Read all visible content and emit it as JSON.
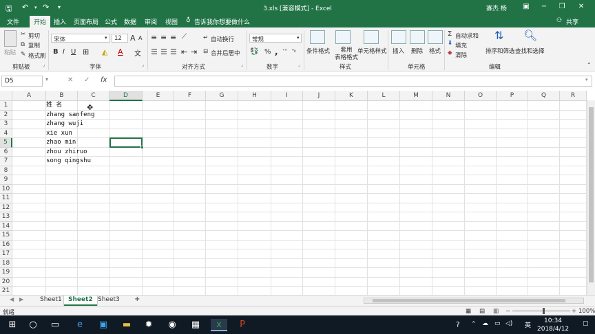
{
  "window": {
    "title": "3.xls [兼容模式] - Excel",
    "user": "寡杰 杨",
    "icons": [
      "save-icon",
      "undo-icon",
      "redo-icon",
      "customize-icon"
    ],
    "controls": [
      "ribbon-display-icon",
      "minimize-icon",
      "maximize-icon",
      "close-icon"
    ]
  },
  "menu": {
    "items": [
      "文件",
      "开始",
      "插入",
      "页面布局",
      "公式",
      "数据",
      "审阅",
      "视图"
    ],
    "active": "开始",
    "tell_me": "告诉我你想要做什么",
    "share": "共享"
  },
  "ribbon": {
    "clipboard": {
      "paste": "粘贴",
      "cut": "剪切",
      "copy": "复制",
      "format_painter": "格式刷",
      "label": "剪贴板"
    },
    "font": {
      "name": "宋体",
      "size": "12",
      "label": "字体",
      "bold": "B",
      "italic": "I",
      "underline": "U",
      "grow": "A",
      "shrink": "A",
      "font_color": "A"
    },
    "alignment": {
      "wrap": "自动换行",
      "merge": "合并后居中",
      "label": "对齐方式"
    },
    "number": {
      "format": "常规",
      "percent": "%",
      "comma": ",",
      "label": "数字"
    },
    "styles": {
      "conditional": "条件格式",
      "table": "套用\n表格格式",
      "cell_styles": "单元格样式",
      "label": "样式"
    },
    "cells": {
      "insert": "插入",
      "delete": "删除",
      "format": "格式",
      "label": "单元格"
    },
    "editing": {
      "autosum": "自动求和",
      "fill": "填充",
      "clear": "清除",
      "sort": "排序和筛选",
      "find": "查找和选择",
      "label": "编辑"
    }
  },
  "formula_bar": {
    "name_box": "D5",
    "fx": "fx",
    "value": ""
  },
  "grid": {
    "columns": [
      "A",
      "B",
      "C",
      "D",
      "E",
      "F",
      "G",
      "H",
      "I",
      "J",
      "K",
      "L",
      "M",
      "N",
      "O",
      "P",
      "Q",
      "R"
    ],
    "selected_column": "D",
    "rows": [
      "1",
      "2",
      "3",
      "4",
      "5",
      "6",
      "7",
      "8",
      "9",
      "10",
      "11",
      "12",
      "13",
      "14",
      "15",
      "16",
      "17",
      "18",
      "19",
      "20",
      "21"
    ],
    "selected_row": "5",
    "active_cell": "D5",
    "cells": [
      {
        "ref": "B1",
        "value": "姓 名"
      },
      {
        "ref": "B2",
        "value": "zhang sanfeng"
      },
      {
        "ref": "B3",
        "value": "zhang wuji"
      },
      {
        "ref": "B4",
        "value": "xie xun"
      },
      {
        "ref": "B5",
        "value": "zhao min"
      },
      {
        "ref": "B6",
        "value": "zhou zhiruo"
      },
      {
        "ref": "B7",
        "value": "song qingshu"
      }
    ]
  },
  "sheets": {
    "tabs": [
      "Sheet1",
      "Sheet2",
      "Sheet3"
    ],
    "active": "Sheet2",
    "add": "+"
  },
  "status": {
    "mode": "就绪",
    "zoom": "100%"
  },
  "taskbar": {
    "time": "10:34",
    "date": "2018/4/12",
    "ime": "英",
    "apps": [
      "start-icon",
      "search-icon",
      "task-view-icon",
      "edge-icon",
      "app-icon",
      "explorer-icon",
      "settings-icon",
      "camera-icon",
      "calculator-icon",
      "excel-icon",
      "powerpoint-icon"
    ]
  }
}
